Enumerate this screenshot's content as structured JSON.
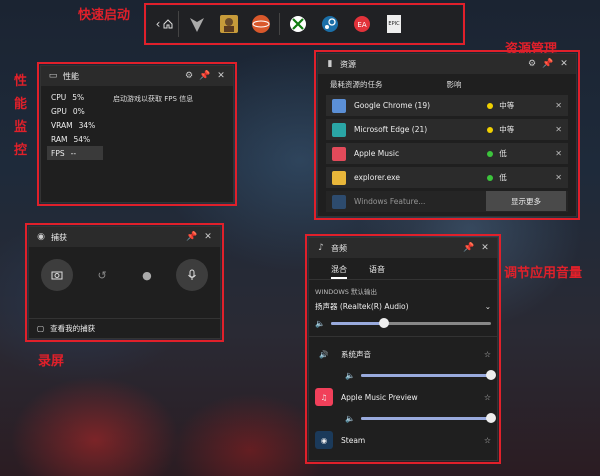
{
  "annotations": {
    "quick_launch": "快速启动",
    "resource_mgmt": "资源管理",
    "perf_monitor": "性能监控",
    "record_screen": "录屏",
    "app_volume": "调节应用音量"
  },
  "launch_bar": {
    "apps": [
      "destiny-icon",
      "game-avatar-icon",
      "game-ball-icon",
      "xbox-icon",
      "steam-icon",
      "ea-icon",
      "epic-icon"
    ],
    "epic_text": "EPIC"
  },
  "performance": {
    "title": "性能",
    "rows": [
      {
        "label": "CPU",
        "value": "5%"
      },
      {
        "label": "GPU",
        "value": "0%"
      },
      {
        "label": "VRAM",
        "value": "34%"
      },
      {
        "label": "RAM",
        "value": "54%"
      },
      {
        "label": "FPS",
        "value": "--"
      }
    ],
    "note": "启动游戏以获取 FPS 信息"
  },
  "resources": {
    "title": "资源",
    "col_task": "最耗资源的任务",
    "col_impact": "影响",
    "rows": [
      {
        "name": "Google Chrome (19)",
        "level": "中等",
        "color": "#f0d000"
      },
      {
        "name": "Microsoft Edge (21)",
        "level": "中等",
        "color": "#f0d000"
      },
      {
        "name": "Apple Music",
        "level": "低",
        "color": "#3cc43c"
      },
      {
        "name": "explorer.exe",
        "level": "低",
        "color": "#3cc43c"
      },
      {
        "name": "Windows Feature...",
        "level": "低",
        "color": "#3cc43c"
      }
    ],
    "show_more": "显示更多"
  },
  "capture": {
    "title": "捕获",
    "view_captures": "查看我的捕获"
  },
  "audio": {
    "title": "音频",
    "tab_mix": "混合",
    "tab_voice": "语音",
    "section_label": "WINDOWS 默认输出",
    "device": "扬声器 (Realtek(R) Audio)",
    "master_level": 0.33,
    "apps": [
      {
        "name": "系统声音",
        "level": 1.0
      },
      {
        "name": "Apple Music Preview",
        "level": 1.0
      },
      {
        "name": "Steam",
        "level": null
      }
    ]
  }
}
